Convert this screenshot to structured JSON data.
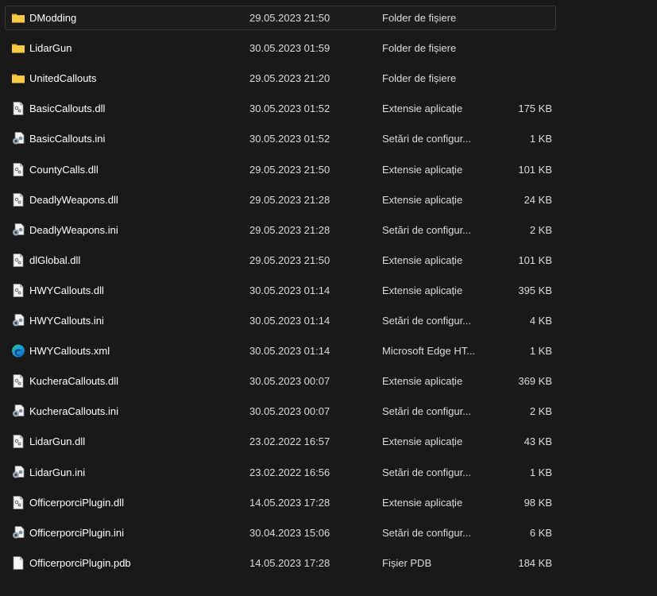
{
  "files": [
    {
      "name": "DModding",
      "date": "29.05.2023 21:50",
      "type": "Folder de fișiere",
      "size": "",
      "icon": "folder-icon",
      "focused": true
    },
    {
      "name": "LidarGun",
      "date": "30.05.2023 01:59",
      "type": "Folder de fișiere",
      "size": "",
      "icon": "folder-icon"
    },
    {
      "name": "UnitedCallouts",
      "date": "29.05.2023 21:20",
      "type": "Folder de fișiere",
      "size": "",
      "icon": "folder-icon"
    },
    {
      "name": "BasicCallouts.dll",
      "date": "30.05.2023 01:52",
      "type": "Extensie aplicație",
      "size": "175 KB",
      "icon": "dll-file-icon"
    },
    {
      "name": "BasicCallouts.ini",
      "date": "30.05.2023 01:52",
      "type": "Setări de configur...",
      "size": "1 KB",
      "icon": "ini-file-icon"
    },
    {
      "name": "CountyCalls.dll",
      "date": "29.05.2023 21:50",
      "type": "Extensie aplicație",
      "size": "101 KB",
      "icon": "dll-file-icon"
    },
    {
      "name": "DeadlyWeapons.dll",
      "date": "29.05.2023 21:28",
      "type": "Extensie aplicație",
      "size": "24 KB",
      "icon": "dll-file-icon"
    },
    {
      "name": "DeadlyWeapons.ini",
      "date": "29.05.2023 21:28",
      "type": "Setări de configur...",
      "size": "2 KB",
      "icon": "ini-file-icon"
    },
    {
      "name": "dlGlobal.dll",
      "date": "29.05.2023 21:50",
      "type": "Extensie aplicație",
      "size": "101 KB",
      "icon": "dll-file-icon"
    },
    {
      "name": "HWYCallouts.dll",
      "date": "30.05.2023 01:14",
      "type": "Extensie aplicație",
      "size": "395 KB",
      "icon": "dll-file-icon"
    },
    {
      "name": "HWYCallouts.ini",
      "date": "30.05.2023 01:14",
      "type": "Setări de configur...",
      "size": "4 KB",
      "icon": "ini-file-icon"
    },
    {
      "name": "HWYCallouts.xml",
      "date": "30.05.2023 01:14",
      "type": "Microsoft Edge HT...",
      "size": "1 KB",
      "icon": "edge-icon"
    },
    {
      "name": "KucheraCallouts.dll",
      "date": "30.05.2023 00:07",
      "type": "Extensie aplicație",
      "size": "369 KB",
      "icon": "dll-file-icon"
    },
    {
      "name": "KucheraCallouts.ini",
      "date": "30.05.2023 00:07",
      "type": "Setări de configur...",
      "size": "2 KB",
      "icon": "ini-file-icon"
    },
    {
      "name": "LidarGun.dll",
      "date": "23.02.2022 16:57",
      "type": "Extensie aplicație",
      "size": "43 KB",
      "icon": "dll-file-icon"
    },
    {
      "name": "LidarGun.ini",
      "date": "23.02.2022 16:56",
      "type": "Setări de configur...",
      "size": "1 KB",
      "icon": "ini-file-icon"
    },
    {
      "name": "OfficerporciPlugin.dll",
      "date": "14.05.2023 17:28",
      "type": "Extensie aplicație",
      "size": "98 KB",
      "icon": "dll-file-icon"
    },
    {
      "name": "OfficerporciPlugin.ini",
      "date": "30.04.2023 15:06",
      "type": "Setări de configur...",
      "size": "6 KB",
      "icon": "ini-file-icon"
    },
    {
      "name": "OfficerporciPlugin.pdb",
      "date": "14.05.2023 17:28",
      "type": "Fișier PDB",
      "size": "184 KB",
      "icon": "pdb-file-icon"
    }
  ],
  "colors": {
    "background": "#191919",
    "folder": "#F4C430",
    "text": "#FFFFFF",
    "edge_blue": "#0C7CD5",
    "edge_green": "#4FC23D"
  }
}
